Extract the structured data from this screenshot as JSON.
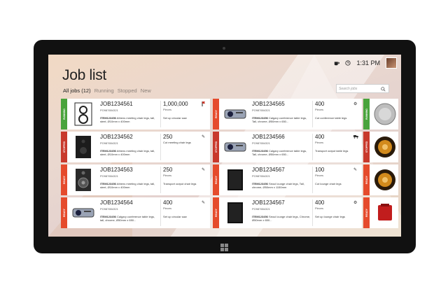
{
  "app": {
    "title": "Job list",
    "time": "1:31 PM",
    "search_placeholder": "Search jobs",
    "filters": [
      {
        "label": "All jobs (12)",
        "active": true
      },
      {
        "label": "Running",
        "active": false
      },
      {
        "label": "Stopped",
        "active": false
      },
      {
        "label": "New",
        "active": false
      }
    ],
    "icons": [
      "coffee-icon",
      "clock-icon",
      "search-icon",
      "windows-icon"
    ],
    "colors": {
      "running": "#4aa33c",
      "stopped": "#c8392c",
      "ready": "#e54b2c"
    }
  },
  "jobs": [
    {
      "status": "RUNNING",
      "job": "JOB1234561",
      "po": "PO98765432​1",
      "item_code": "ITEM123456",
      "item_desc": "Athens meeting chair legs, tall, steel, Ø10mm x 400mm",
      "qty": "1,000,000",
      "unit": "Pieces",
      "operation": "Set up circular saw",
      "op_icon": "flag-icon",
      "thumb": "speaker-white"
    },
    {
      "status": "STOPPED",
      "job": "JOB1234562",
      "po": "PO98765432​1",
      "item_code": "ITEM123456",
      "item_desc": "Athens meeting chair legs, tall, steel, Ø10mm x 400mm",
      "qty": "250",
      "unit": "Pieces",
      "operation": "Cut meeting chair legs",
      "op_icon": "wrench-icon",
      "thumb": "speaker-black"
    },
    {
      "status": "READY",
      "job": "JOB1234563",
      "po": "PO98765432​1",
      "item_code": "ITEM123456",
      "item_desc": "Athens meeting chair legs, tall, steel, Ø10mm x 400mm",
      "qty": "250",
      "unit": "Pieces",
      "operation": "Transport output chair legs",
      "op_icon": "wrench-icon",
      "thumb": "speaker-dark"
    },
    {
      "status": "READY",
      "job": "JOB1234564",
      "po": "PO98765432​1",
      "item_code": "ITEM123456",
      "item_desc": "Calgary conference table legs, tall, chrome, Ø50mm x 650...",
      "qty": "400",
      "unit": "Pieces",
      "operation": "Set up circular saw",
      "op_icon": "wrench-icon",
      "thumb": "projector"
    },
    {
      "status": "READY",
      "job": "JOB1234565",
      "po": "PO98765432​1",
      "item_code": "ITEM123456",
      "item_desc": "Calgary conference table legs, Tall, chrome, Ø50mm x 650...",
      "qty": "400",
      "unit": "Pieces",
      "operation": "Cut conference table legs",
      "op_icon": "gear-icon",
      "thumb": "projector"
    },
    {
      "status": "STOPPED",
      "job": "JOB1234566",
      "po": "PO98765432​1",
      "item_code": "ITEM123456",
      "item_desc": "Calgary conference table legs, Tall, chrome, Ø50mm x 650...",
      "qty": "400",
      "unit": "Pieces",
      "operation": "Transport output table legs",
      "op_icon": "truck-icon",
      "thumb": "projector"
    },
    {
      "status": "READY",
      "job": "JOB1234567",
      "po": "PO98765432​1",
      "item_code": "ITEM123456",
      "item_desc": "Seoul lounge chair legs, Tall, chrome, Ø50mm x 1150mm",
      "qty": "100",
      "unit": "Pieces",
      "operation": "Cut lounge chair legs",
      "op_icon": "wrench-icon",
      "thumb": "speaker-black"
    },
    {
      "status": "READY",
      "job": "JOB1234567",
      "po": "PO98765432​1",
      "item_code": "ITEM123456",
      "item_desc": "Seoul lounge chair legs, Chrome, Ø50mm x 650...",
      "qty": "400",
      "unit": "Pieces",
      "operation": "Set up lounge chair legs",
      "op_icon": "gear-icon",
      "thumb": "speaker-black"
    }
  ],
  "mini_cards": [
    {
      "status": "RUNNING",
      "thumb": "speaker-silver"
    },
    {
      "status": "STOPPED",
      "thumb": "speaker-gold"
    },
    {
      "status": "READY",
      "thumb": "speaker-gold"
    },
    {
      "status": "READY",
      "thumb": "box-red"
    }
  ]
}
